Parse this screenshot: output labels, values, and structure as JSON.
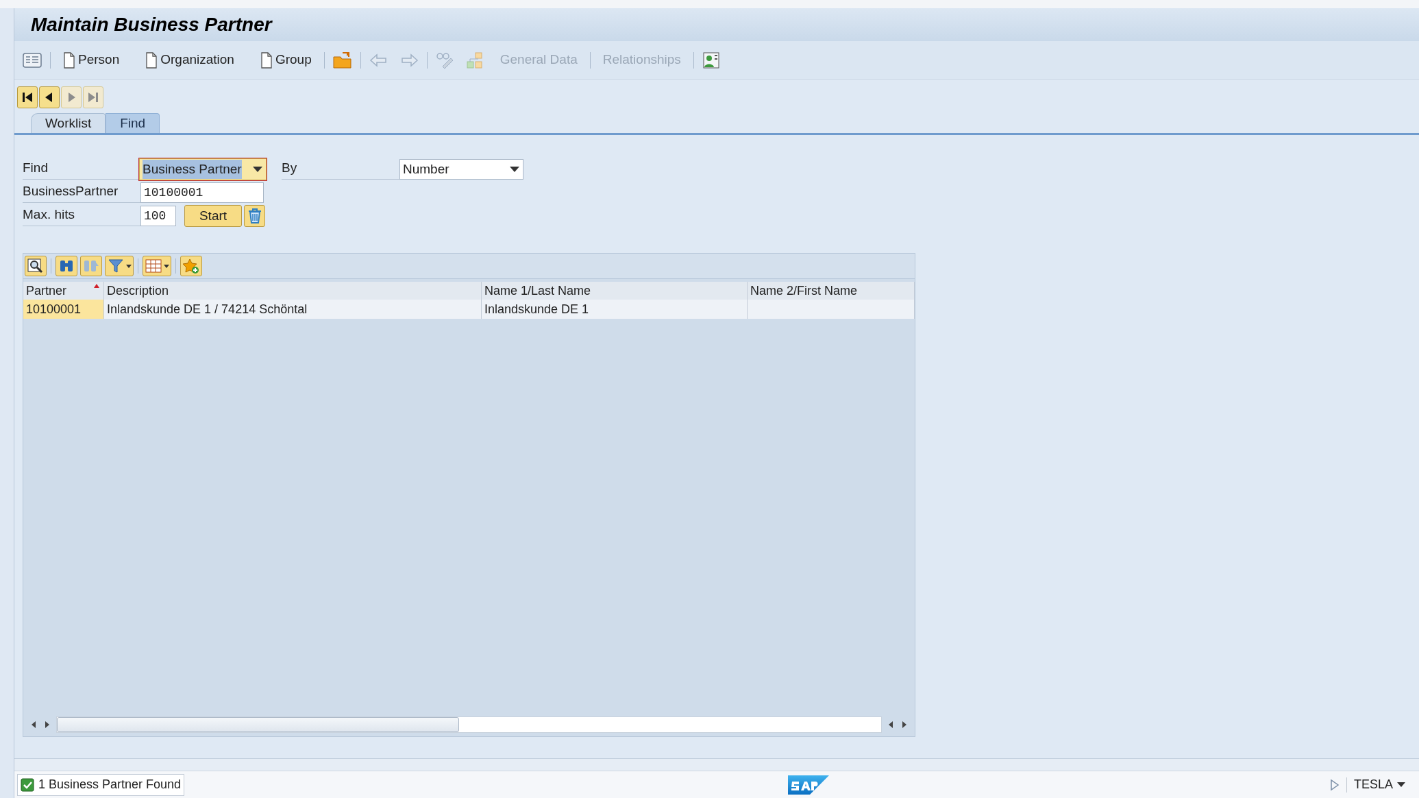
{
  "window": {
    "title": "Maintain Business Partner"
  },
  "toolbar": {
    "buttons": [
      {
        "label": "Person",
        "disabled": false
      },
      {
        "label": "Organization",
        "disabled": false
      },
      {
        "label": "Group",
        "disabled": false
      },
      {
        "label": "General Data",
        "disabled": true
      },
      {
        "label": "Relationships",
        "disabled": true
      }
    ]
  },
  "tabs": [
    {
      "label": "Worklist",
      "selected": false
    },
    {
      "label": "Find",
      "selected": true
    }
  ],
  "search": {
    "find_label": "Find",
    "find_value": "Business Partner",
    "find_focused": true,
    "by_label": "By",
    "by_value": "Number",
    "partner_label": "BusinessPartner",
    "partner_value": "10100001",
    "max_hits_label": "Max. hits",
    "max_hits_value": "100",
    "start_button": "Start"
  },
  "table": {
    "columns": [
      {
        "label": "Partner",
        "sorted": true,
        "key": true
      },
      {
        "label": "Description",
        "sorted": false,
        "key": false
      },
      {
        "label": "Name 1/Last Name",
        "sorted": false,
        "key": false
      },
      {
        "label": "Name 2/First Name",
        "sorted": false,
        "key": false
      }
    ],
    "rows": [
      [
        "10100001",
        "Inlandskunde DE 1 / 74214 Schöntal",
        "Inlandskunde DE 1",
        ""
      ]
    ]
  },
  "status_bar": {
    "success": true,
    "message": "1 Business Partner Found",
    "system": "TESLA"
  }
}
